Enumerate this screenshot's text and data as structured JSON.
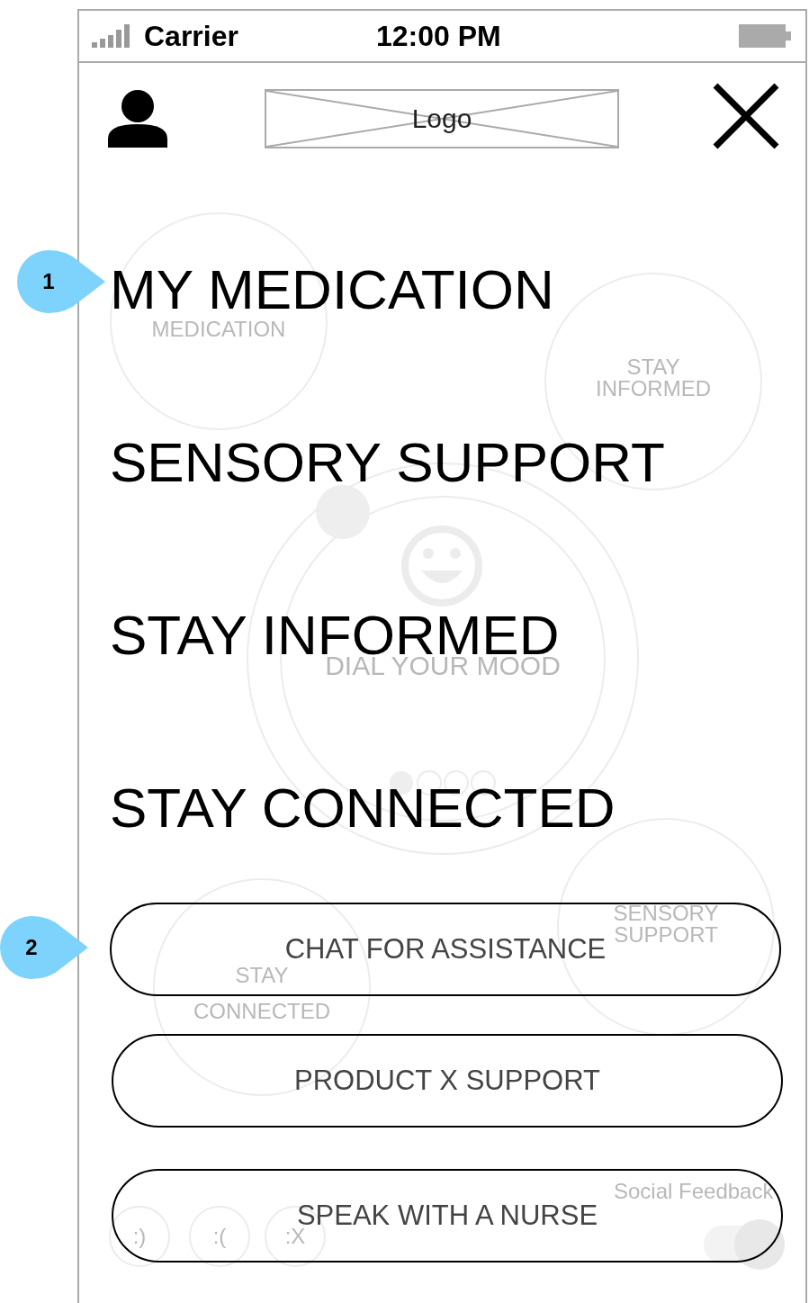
{
  "status_bar": {
    "carrier": "Carrier",
    "time": "12:00 PM"
  },
  "header": {
    "logo": "Logo"
  },
  "menu": [
    {
      "label": "MY MEDICATION"
    },
    {
      "label": "SENSORY SUPPORT"
    },
    {
      "label": "STAY INFORMED"
    },
    {
      "label": "STAY CONNECTED"
    }
  ],
  "buttons": [
    {
      "label": "CHAT FOR ASSISTANCE"
    },
    {
      "label": "PRODUCT X SUPPORT"
    },
    {
      "label": "SPEAK WITH A NURSE"
    }
  ],
  "callouts": [
    {
      "number": "1"
    },
    {
      "number": "2"
    }
  ],
  "background_screen": {
    "tiles": [
      {
        "lines": [
          "MEDICATION"
        ]
      },
      {
        "lines": [
          "STAY",
          "INFORMED"
        ]
      },
      {
        "lines": [
          "SENSORY",
          "SUPPORT"
        ]
      },
      {
        "lines": [
          "STAY",
          "CONNECTED"
        ]
      }
    ],
    "dial_label": "DIAL YOUR MOOD",
    "social_feedback": "Social Feedback",
    "reactions": [
      ":)",
      ":(",
      ":X"
    ],
    "toggle": {
      "on": true
    }
  }
}
